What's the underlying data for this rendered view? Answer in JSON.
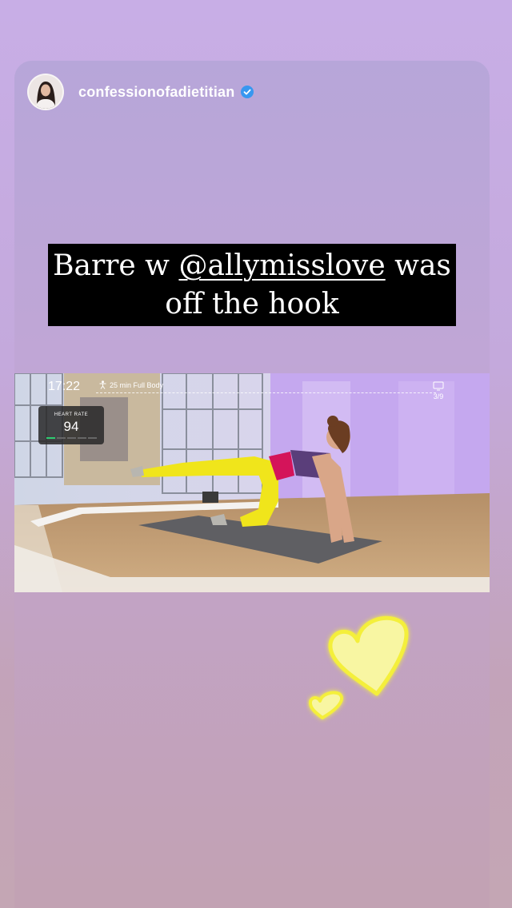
{
  "story": {
    "username": "confessionofadietitian",
    "verified": true,
    "caption": {
      "line1_before": "Barre w ",
      "mention": "@allymisslove",
      "line1_after": " was",
      "line2": "off the hook"
    }
  },
  "video": {
    "time": "17:22",
    "class_name": "25 min Full Body",
    "heart_rate_label": "HEART RATE",
    "heart_rate_value": "94",
    "right_indicator": "3/9"
  },
  "icons": [
    "verified-badge-icon",
    "person-icon",
    "screen-icon",
    "heart-sticker-icon"
  ],
  "colors": {
    "background_top": "#c8aee6",
    "background_bottom": "#c4a6b4",
    "caption_bg": "#000000",
    "heart_fill": "#f8f6a2",
    "heart_glow": "#f4ef3a",
    "verified": "#3897f0"
  }
}
